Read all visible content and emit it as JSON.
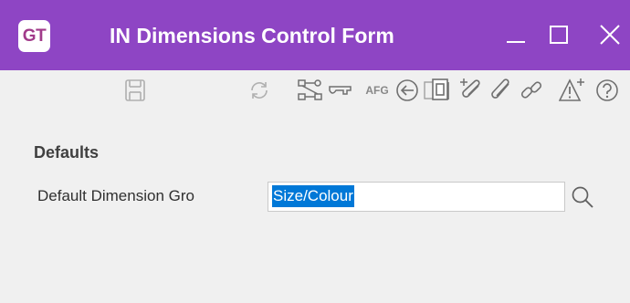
{
  "window": {
    "app_badge": "GT",
    "title": "IN Dimensions Control Form",
    "controls": [
      "minimize-icon",
      "maximize-icon",
      "close-icon"
    ]
  },
  "toolbar": {
    "afg_label": "AFG",
    "icons": [
      "save-icon",
      "refresh-icon",
      "workflow-icon",
      "key-icon",
      "afg-icon",
      "back-arrow-icon",
      "preview-icon",
      "add-attachment-icon",
      "attachment-icon",
      "link-icon",
      "add-alert-icon",
      "help-icon"
    ]
  },
  "form": {
    "section_title": "Defaults",
    "default_dimension_group": {
      "label": "Default Dimension Gro",
      "value": "Size/Colour"
    }
  },
  "colors": {
    "titlebar": "#8e45c4",
    "background": "#f0f0f0",
    "selection": "#0078d7"
  }
}
